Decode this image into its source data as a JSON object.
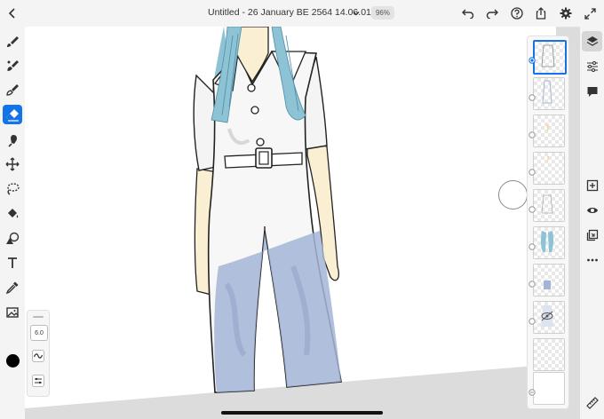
{
  "topbar": {
    "title": "Untitled - 26 January BE 2564 14.06.01 *",
    "zoom": "96%"
  },
  "brush_panel": {
    "size": "6.0"
  },
  "icons": {
    "back": "chevron-left-icon",
    "title_menu": "chevron-down-icon",
    "undo": "undo-icon",
    "redo": "redo-icon",
    "help": "help-icon",
    "share": "share-icon",
    "settings": "gear-icon",
    "fullscreen": "expand-icon"
  },
  "left_tools": [
    "pixel-brush-icon",
    "live-brush-icon",
    "vector-brush-icon",
    "eraser-icon",
    "smudge-icon",
    "transform-icon",
    "lasso-icon",
    "fill-icon",
    "shapes-icon",
    "text-icon",
    "eyedropper-icon",
    "image-icon"
  ],
  "active_tool": "eraser-icon",
  "current_color": "#000000",
  "layers": {
    "count": 10,
    "selected_index": 0,
    "hidden_index": 7
  },
  "right_tools": [
    "layers-icon",
    "layer-properties-icon",
    "comments-icon",
    "add-layer-icon",
    "visibility-icon",
    "merge-down-icon",
    "more-icon"
  ],
  "colors": {
    "accent": "#1473e6",
    "hair": "#8ec3d6",
    "pants_shading": "#a3b5d6",
    "skin": "#fbefd3"
  }
}
